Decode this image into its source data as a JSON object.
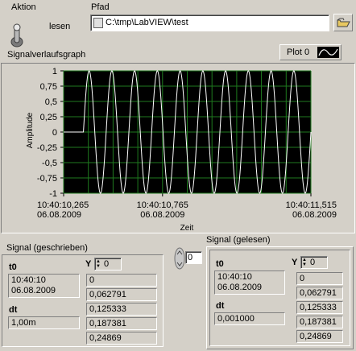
{
  "controls": {
    "action_label": "Aktion",
    "toggle_label": "lesen",
    "path_label": "Pfad",
    "path_value": "C:\\tmp\\LabVIEW\\test"
  },
  "graph": {
    "title": "Signalverlaufsgraph",
    "legend_label": "Plot 0",
    "y_axis_label": "Amplitude",
    "x_axis_label": "Zeit",
    "y_ticks": [
      "1",
      "0,75",
      "0,5",
      "0,25",
      "0",
      "-0,25",
      "-0,5",
      "-0,75",
      "-1"
    ],
    "x_ticks": [
      {
        "time": "10:40:10,265",
        "date": "06.08.2009"
      },
      {
        "time": "10:40:10,765",
        "date": "06.08.2009"
      },
      {
        "time": "10:40:11,515",
        "date": "06.08.2009"
      }
    ]
  },
  "chart_data": {
    "type": "line",
    "title": "Signalverlaufsgraph",
    "xlabel": "Zeit",
    "ylabel": "Amplitude",
    "ylim": [
      -1,
      1
    ],
    "xlim": [
      "10:40:10,265",
      "10:40:11,515"
    ],
    "series": [
      {
        "name": "Plot 0",
        "waveform": "sine",
        "amplitude": 1,
        "start_time": "10:40:10,265",
        "dt_s": 0.001,
        "cycles_visible": 10,
        "first_samples": [
          0,
          0.062791,
          0.125333,
          0.187381,
          0.24869
        ]
      }
    ],
    "flat_until": "10:40:10,365",
    "grid": true,
    "colors": {
      "plot_background": "#000000",
      "grid": "#1f7a1f",
      "trace": "#ffffff"
    }
  },
  "written": {
    "title": "Signal (geschrieben)",
    "t0_label": "t0",
    "t0_time": "10:40:10",
    "t0_date": "06.08.2009",
    "dt_label": "dt",
    "dt_value": "1,00m",
    "y_label": "Y",
    "y_index": "0",
    "y_values": [
      "0",
      "0,062791",
      "0,125333",
      "0,187381",
      "0,24869"
    ]
  },
  "index_control": {
    "value": "0"
  },
  "read": {
    "title": "Signal (gelesen)",
    "t0_label": "t0",
    "t0_time": "10:40:10",
    "t0_date": "06.08.2009",
    "dt_label": "dt",
    "dt_value": "0,001000",
    "y_label": "Y",
    "y_index": "0",
    "y_values": [
      "0",
      "0,062791",
      "0,125333",
      "0,187381",
      "0,24869"
    ]
  }
}
